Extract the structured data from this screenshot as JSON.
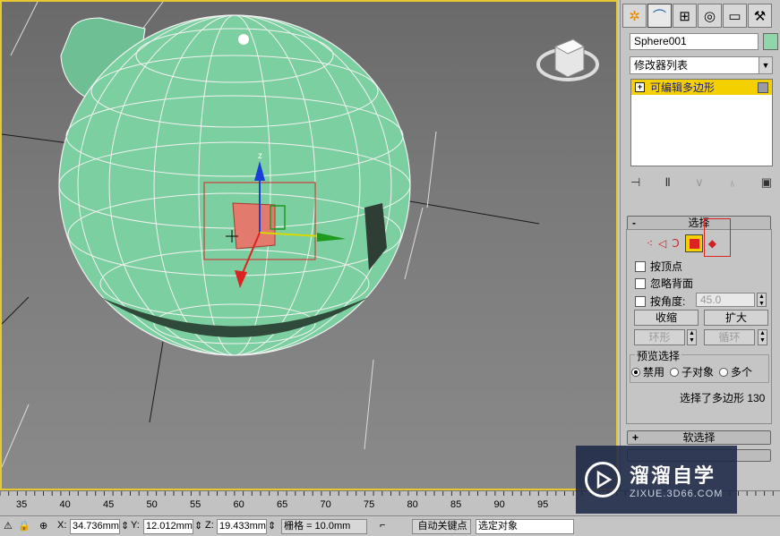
{
  "command_panel": {
    "tabs": [
      {
        "icon": "create-icon"
      },
      {
        "icon": "modify-icon"
      },
      {
        "icon": "hierarchy-icon"
      },
      {
        "icon": "motion-icon"
      },
      {
        "icon": "display-icon"
      },
      {
        "icon": "utilities-icon"
      }
    ],
    "object_name": "Sphere001",
    "object_color": "#8fd6a8",
    "modifier_list": "修改器列表",
    "stack_item": "可编辑多边形",
    "selection_rollout": {
      "title": "选择",
      "by_vertex": "按顶点",
      "ignore_backfacing": "忽略背面",
      "by_angle": "按角度:",
      "angle_value": "45.0",
      "shrink": "收缩",
      "grow": "扩大",
      "ring": "环形",
      "loop": "循环",
      "preview_label": "预览选择",
      "preview_options": [
        {
          "label": "禁用",
          "selected": true
        },
        {
          "label": "子对象",
          "selected": false
        },
        {
          "label": "多个",
          "selected": false
        }
      ],
      "status": "选择了多边形 130"
    },
    "soft_selection_title": "软选择"
  },
  "viewport": {
    "gizmo_label": "z"
  },
  "timeline": {
    "ticks": [
      "35",
      "40",
      "45",
      "50",
      "55",
      "60",
      "65",
      "70",
      "75",
      "80",
      "85",
      "90",
      "95"
    ]
  },
  "statusbar": {
    "x_label": "X:",
    "x_value": "34.736mm",
    "y_label": "Y:",
    "y_value": "12.012mm",
    "z_label": "Z:",
    "z_value": "19.433mm",
    "grid": "栅格 = 10.0mm",
    "auto_key": "自动关键点",
    "set_key_mode": "选定对象"
  },
  "watermark": {
    "title": "溜溜自学",
    "subtitle": "ZIXUE.3D66.COM"
  }
}
